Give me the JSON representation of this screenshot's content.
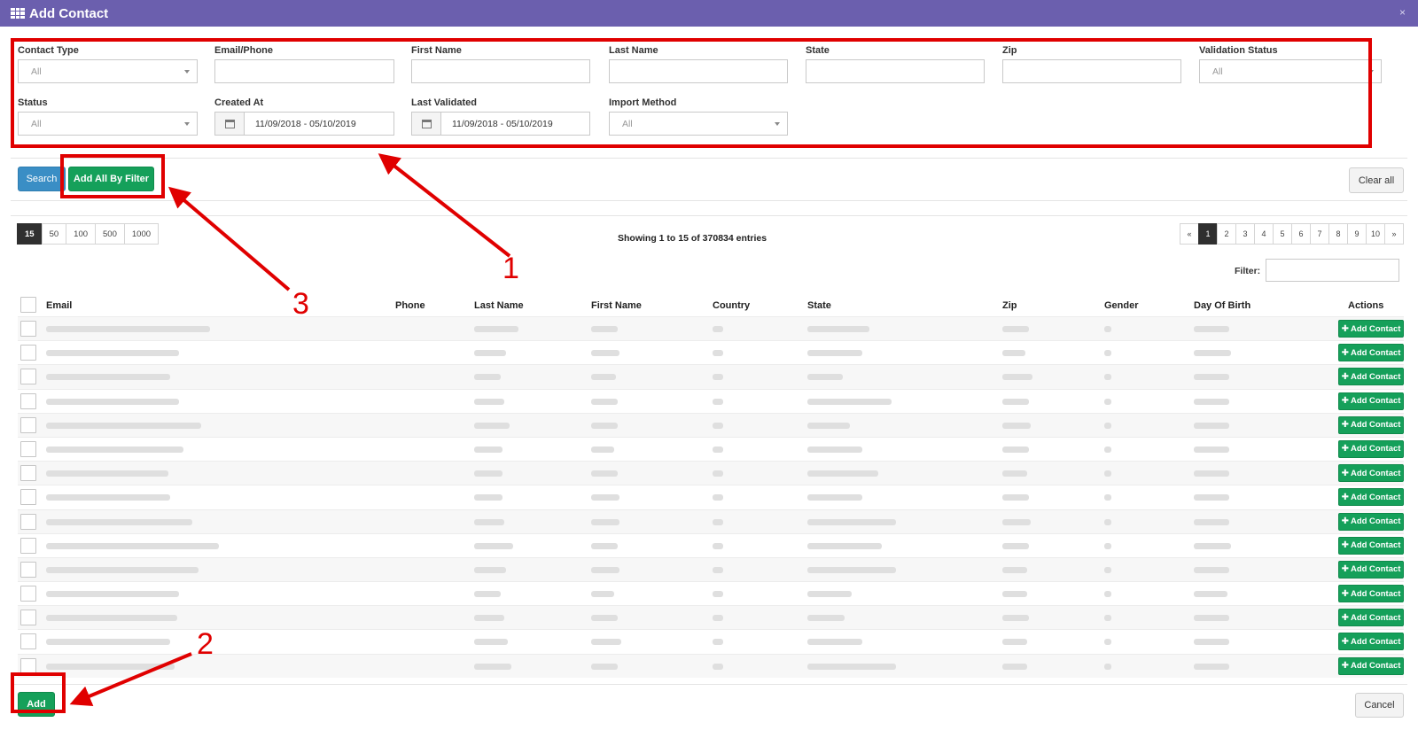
{
  "window": {
    "title": "Add Contact",
    "close": "×",
    "title_icon": "grid-icon"
  },
  "filters": {
    "contact_type": {
      "label": "Contact Type",
      "value": "All"
    },
    "email_phone": {
      "label": "Email/Phone",
      "value": ""
    },
    "first_name": {
      "label": "First Name",
      "value": ""
    },
    "last_name": {
      "label": "Last Name",
      "value": ""
    },
    "state": {
      "label": "State",
      "value": ""
    },
    "zip": {
      "label": "Zip",
      "value": ""
    },
    "validation_status": {
      "label": "Validation Status",
      "value": "All"
    },
    "status": {
      "label": "Status",
      "value": "All"
    },
    "created_at": {
      "label": "Created At",
      "value": "11/09/2018 - 05/10/2019"
    },
    "last_validated": {
      "label": "Last Validated",
      "value": "11/09/2018 - 05/10/2019"
    },
    "import_method": {
      "label": "Import Method",
      "value": "All"
    }
  },
  "toolbar": {
    "search_label": "Search",
    "add_all_label": "Add All By Filter",
    "clear_label": "Clear all"
  },
  "page_sizes": [
    "15",
    "50",
    "100",
    "500",
    "1000"
  ],
  "active_page_size": "15",
  "showing_text": "Showing 1 to 15 of 370834 entries",
  "pagination": [
    "«",
    "1",
    "2",
    "3",
    "4",
    "5",
    "6",
    "7",
    "8",
    "9",
    "10",
    "»"
  ],
  "active_page": "1",
  "table_filter": {
    "label": "Filter:",
    "value": ""
  },
  "table": {
    "columns": [
      "Email",
      "Phone",
      "Last Name",
      "First Name",
      "Country",
      "State",
      "Zip",
      "Gender",
      "Day Of Birth",
      "Actions"
    ],
    "row_count": 15,
    "row_action_label": "Add Contact"
  },
  "footer": {
    "add_label": "Add",
    "cancel_label": "Cancel"
  },
  "annotations": {
    "one": "1",
    "two": "2",
    "three": "3",
    "color": "#e00000"
  },
  "colors": {
    "titlebar": "#6b5fae",
    "primary": "#3a8ec5",
    "success": "#15a05a"
  }
}
